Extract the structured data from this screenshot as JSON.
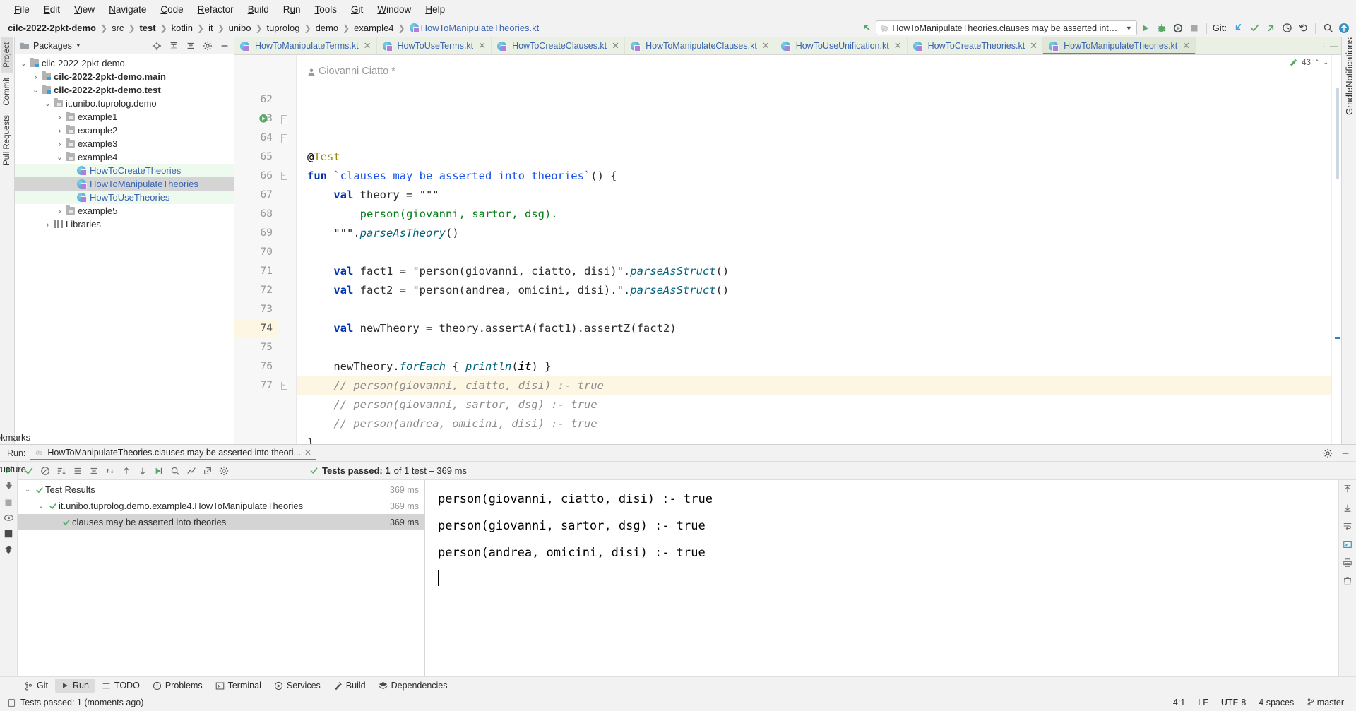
{
  "menu": {
    "items": [
      {
        "label": "File",
        "mnemonic": "F"
      },
      {
        "label": "Edit",
        "mnemonic": "E"
      },
      {
        "label": "View",
        "mnemonic": "V"
      },
      {
        "label": "Navigate",
        "mnemonic": "N"
      },
      {
        "label": "Code",
        "mnemonic": "C"
      },
      {
        "label": "Refactor",
        "mnemonic": "R"
      },
      {
        "label": "Build",
        "mnemonic": "B"
      },
      {
        "label": "Run",
        "mnemonic": "u"
      },
      {
        "label": "Tools",
        "mnemonic": "T"
      },
      {
        "label": "Git",
        "mnemonic": "G"
      },
      {
        "label": "Window",
        "mnemonic": "W"
      },
      {
        "label": "Help",
        "mnemonic": "H"
      }
    ]
  },
  "breadcrumbs": [
    {
      "label": "cilc-2022-2pkt-demo",
      "style": "bold"
    },
    {
      "label": "src",
      "style": "plain"
    },
    {
      "label": "test",
      "style": "bold"
    },
    {
      "label": "kotlin",
      "style": "plain"
    },
    {
      "label": "it",
      "style": "plain"
    },
    {
      "label": "unibo",
      "style": "plain"
    },
    {
      "label": "tuprolog",
      "style": "plain"
    },
    {
      "label": "demo",
      "style": "plain"
    },
    {
      "label": "example4",
      "style": "plain"
    },
    {
      "label": "HowToManipulateTheories.kt",
      "style": "file"
    }
  ],
  "toolbar": {
    "run_config": "HowToManipulateTheories.clauses may be asserted into theories",
    "git_label": "Git:",
    "buttons": [
      {
        "name": "back-arrow-icon",
        "glyph": "arrow-back"
      },
      {
        "name": "run-button",
        "glyph": "play"
      },
      {
        "name": "debug-button",
        "glyph": "bug"
      },
      {
        "name": "run-coverage-button",
        "glyph": "coverage"
      },
      {
        "name": "stop-button",
        "glyph": "stop"
      },
      {
        "name": "git-update-button",
        "glyph": "pull"
      },
      {
        "name": "git-commit-button",
        "glyph": "check"
      },
      {
        "name": "git-push-button",
        "glyph": "push"
      },
      {
        "name": "git-history-button",
        "glyph": "clock"
      },
      {
        "name": "git-rollback-button",
        "glyph": "undo"
      },
      {
        "name": "search-everywhere-button",
        "glyph": "search"
      },
      {
        "name": "updates-button",
        "glyph": "update-badge"
      }
    ]
  },
  "left_rail": {
    "tabs": [
      {
        "label": "Project",
        "active": true
      },
      {
        "label": "Commit",
        "active": false
      },
      {
        "label": "Pull Requests",
        "active": false
      }
    ]
  },
  "right_rail": {
    "tabs": [
      {
        "label": "Notifications",
        "active": false
      },
      {
        "label": "Gradle",
        "active": false
      }
    ]
  },
  "bottom_left_rail": {
    "tabs": [
      {
        "label": "Bookmarks",
        "active": false
      },
      {
        "label": "Structure",
        "active": false
      }
    ]
  },
  "project_panel": {
    "title": "Packages",
    "tree": [
      {
        "indent": 0,
        "arrow": "down",
        "icon": "module-icon",
        "label": "cilc-2022-2pkt-demo",
        "bold": false,
        "highlight": "none",
        "blue": false
      },
      {
        "indent": 1,
        "arrow": "right",
        "icon": "module-icon",
        "label": "cilc-2022-2pkt-demo.main",
        "bold": true,
        "highlight": "none",
        "blue": false
      },
      {
        "indent": 1,
        "arrow": "down",
        "icon": "module-icon",
        "label": "cilc-2022-2pkt-demo.test",
        "bold": true,
        "highlight": "none",
        "blue": false
      },
      {
        "indent": 2,
        "arrow": "down",
        "icon": "package-icon",
        "label": "it.unibo.tuprolog.demo",
        "bold": false,
        "highlight": "none",
        "blue": false
      },
      {
        "indent": 3,
        "arrow": "right",
        "icon": "package-icon",
        "label": "example1",
        "bold": false,
        "highlight": "none",
        "blue": false
      },
      {
        "indent": 3,
        "arrow": "right",
        "icon": "package-icon",
        "label": "example2",
        "bold": false,
        "highlight": "none",
        "blue": false
      },
      {
        "indent": 3,
        "arrow": "right",
        "icon": "package-icon",
        "label": "example3",
        "bold": false,
        "highlight": "none",
        "blue": false
      },
      {
        "indent": 3,
        "arrow": "down",
        "icon": "package-icon",
        "label": "example4",
        "bold": false,
        "highlight": "none",
        "blue": false
      },
      {
        "indent": 4,
        "arrow": "none",
        "icon": "kotlin-class-icon",
        "label": "HowToCreateTheories",
        "bold": false,
        "highlight": "green",
        "blue": true
      },
      {
        "indent": 4,
        "arrow": "none",
        "icon": "kotlin-class-icon",
        "label": "HowToManipulateTheories",
        "bold": false,
        "highlight": "selected",
        "blue": true
      },
      {
        "indent": 4,
        "arrow": "none",
        "icon": "kotlin-class-icon",
        "label": "HowToUseTheories",
        "bold": false,
        "highlight": "green",
        "blue": true
      },
      {
        "indent": 3,
        "arrow": "right",
        "icon": "package-icon",
        "label": "example5",
        "bold": false,
        "highlight": "none",
        "blue": false
      },
      {
        "indent": 2,
        "arrow": "right",
        "icon": "library-icon",
        "label": "Libraries",
        "bold": false,
        "highlight": "none",
        "blue": false
      }
    ]
  },
  "editor_tabs": [
    {
      "label": "HowToManipulateTerms.kt",
      "active": false
    },
    {
      "label": "HowToUseTerms.kt",
      "active": false
    },
    {
      "label": "HowToCreateClauses.kt",
      "active": false
    },
    {
      "label": "HowToManipulateClauses.kt",
      "active": false
    },
    {
      "label": "HowToUseUnification.kt",
      "active": false
    },
    {
      "label": "HowToCreateTheories.kt",
      "active": false
    },
    {
      "label": "HowToManipulateTheories.kt",
      "active": true
    }
  ],
  "editor": {
    "author_annotation": "Giovanni Ciatto *",
    "inspection_count": "43",
    "first_line_number": 62,
    "current_line": 74,
    "lines": [
      {
        "num": 62,
        "fold": "none"
      },
      {
        "num": 63,
        "fold": "down",
        "gutter_icon": "run-test-icon"
      },
      {
        "num": 64,
        "fold": "down"
      },
      {
        "num": 65,
        "fold": "none"
      },
      {
        "num": 66,
        "fold": "up"
      },
      {
        "num": 67,
        "fold": "none"
      },
      {
        "num": 68,
        "fold": "none"
      },
      {
        "num": 69,
        "fold": "none"
      },
      {
        "num": 70,
        "fold": "none"
      },
      {
        "num": 71,
        "fold": "none"
      },
      {
        "num": 72,
        "fold": "none"
      },
      {
        "num": 73,
        "fold": "none"
      },
      {
        "num": 74,
        "fold": "none"
      },
      {
        "num": 75,
        "fold": "none"
      },
      {
        "num": 76,
        "fold": "none"
      },
      {
        "num": 77,
        "fold": "up"
      }
    ],
    "code_text": [
      "@Test",
      "fun `clauses may be asserted into theories`() {",
      "    val theory = \"\"\"",
      "        person(giovanni, sartor, dsg).",
      "    \"\"\".parseAsTheory()",
      "",
      "    val fact1 = \"person(giovanni, ciatto, disi)\".parseAsStruct()",
      "    val fact2 = \"person(andrea, omicini, disi).\".parseAsStruct()",
      "",
      "    val newTheory = theory.assertA(fact1).assertZ(fact2)",
      "",
      "    newTheory.forEach { println(it) }",
      "    // person(giovanni, ciatto, disi) :- true",
      "    // person(giovanni, sartor, dsg) :- true",
      "    // person(andrea, omicini, disi) :- true",
      "}"
    ]
  },
  "run_panel": {
    "tab_prefix": "Run:",
    "tab_label": "HowToManipulateTheories.clauses may be asserted into theori...",
    "summary": "Tests passed: 1",
    "summary_detail": "of 1 test – 369 ms",
    "tree": [
      {
        "indent": 0,
        "arrow": "down",
        "label": "Test Results",
        "time": "369 ms",
        "selected": false
      },
      {
        "indent": 1,
        "arrow": "down",
        "label": "it.unibo.tuprolog.demo.example4.HowToManipulateTheories",
        "time": "369 ms",
        "selected": false
      },
      {
        "indent": 2,
        "arrow": "none",
        "label": "clauses may be asserted into theories",
        "time": "369 ms",
        "selected": true
      }
    ],
    "console_lines": [
      "person(giovanni, ciatto, disi) :- true",
      "person(giovanni, sartor, dsg) :- true",
      "person(andrea, omicini, disi) :- true"
    ]
  },
  "bottom_tabs": [
    {
      "label": "Git",
      "icon": "git-icon",
      "active": false
    },
    {
      "label": "Run",
      "icon": "play-icon",
      "active": true
    },
    {
      "label": "TODO",
      "icon": "todo-icon",
      "active": false
    },
    {
      "label": "Problems",
      "icon": "problems-icon",
      "active": false
    },
    {
      "label": "Terminal",
      "icon": "terminal-icon",
      "active": false
    },
    {
      "label": "Services",
      "icon": "services-icon",
      "active": false
    },
    {
      "label": "Build",
      "icon": "build-icon",
      "active": false
    },
    {
      "label": "Dependencies",
      "icon": "dependencies-icon",
      "active": false
    }
  ],
  "status_bar": {
    "message": "Tests passed: 1 (moments ago)",
    "caret_position": "4:1",
    "line_separator": "LF",
    "encoding": "UTF-8",
    "indent": "4 spaces",
    "branch": "master"
  },
  "colors": {
    "accent_blue": "#3a64b0",
    "green": "#49a749",
    "tab_bg_green": "#eaf0e4",
    "selection_gray": "#d4d4d4",
    "current_line": "#fdf6e3"
  }
}
